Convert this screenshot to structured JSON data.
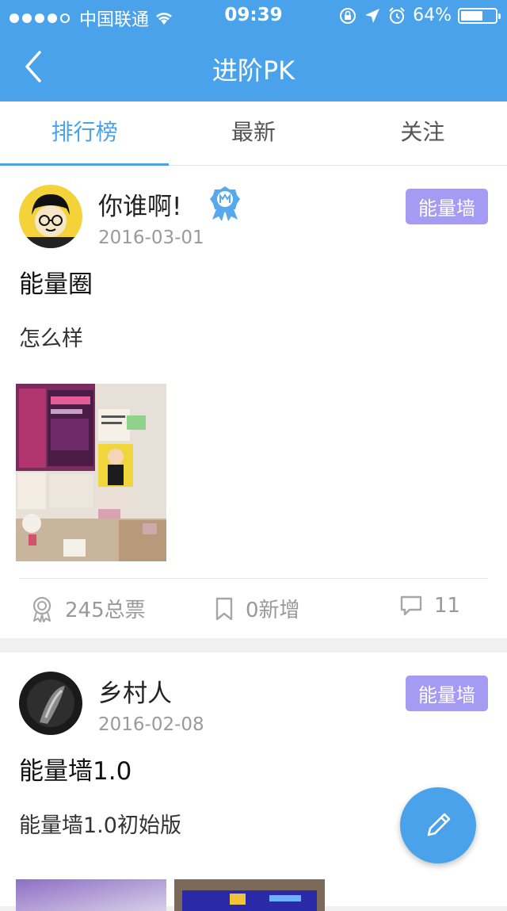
{
  "status_bar": {
    "carrier": "中国联通",
    "time": "09:39",
    "battery_percent": "64%",
    "battery_level": 0.64,
    "signal_bars_filled": 4,
    "signal_bars_total": 5
  },
  "nav": {
    "title": "进阶PK",
    "back_icon": "chevron-left-icon"
  },
  "tabs": [
    {
      "label": "排行榜",
      "active": true
    },
    {
      "label": "最新",
      "active": false
    },
    {
      "label": "关注",
      "active": false
    }
  ],
  "posts": [
    {
      "username": "你谁啊!",
      "date": "2016-03-01",
      "badge": "能量墙",
      "title": "能量圈",
      "body": "怎么样",
      "votes": "245总票",
      "new_count": "0新增",
      "comments": "11"
    },
    {
      "username": "乡村人",
      "date": "2016-02-08",
      "badge": "能量墙",
      "title": "能量墙1.0",
      "body": "能量墙1.0初始版"
    }
  ],
  "colors": {
    "primary": "#4aa3ea",
    "badge": "#a69bf2",
    "muted_text": "#9a9a9a"
  },
  "icons": {
    "fab": "pencil-icon",
    "votes": "medal-icon",
    "new": "bookmark-icon",
    "comments": "comment-icon",
    "verified": "verified-badge-icon"
  }
}
